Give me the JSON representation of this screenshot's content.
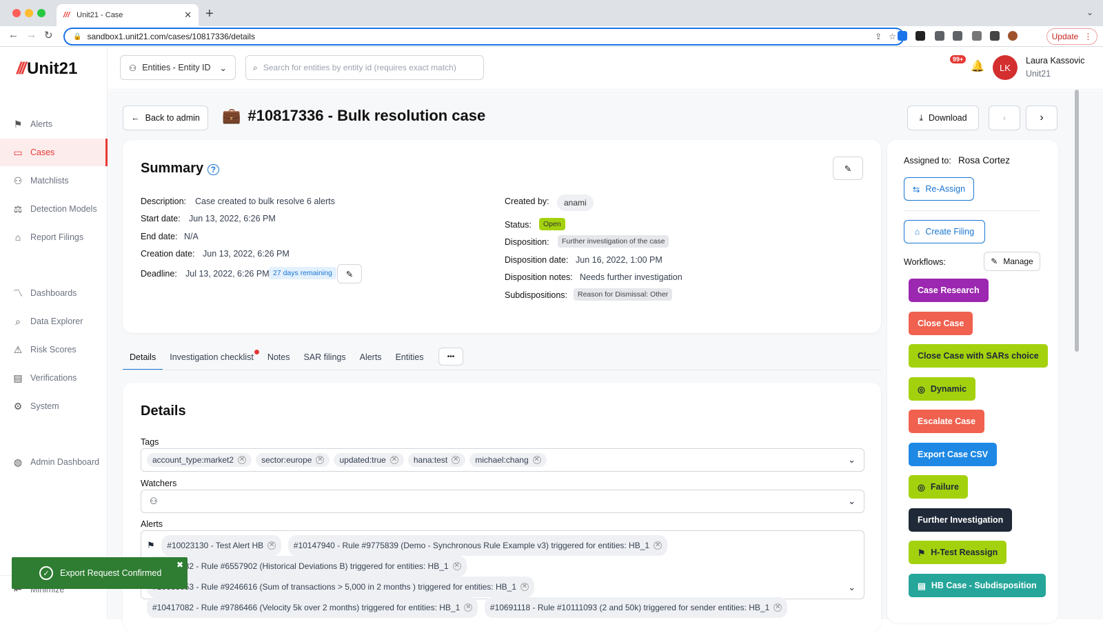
{
  "browser": {
    "tab_title": "Unit21 - Case",
    "url": "sandbox1.unit21.com/cases/10817336/details",
    "update_label": "Update"
  },
  "app": {
    "logo": "Unit21"
  },
  "sidebar": {
    "items": [
      {
        "label": "Alerts",
        "icon": "flag-icon"
      },
      {
        "label": "Cases",
        "icon": "briefcase-icon",
        "active": true
      },
      {
        "label": "Matchlists",
        "icon": "user-x-icon"
      },
      {
        "label": "Detection Models",
        "icon": "scale-icon"
      },
      {
        "label": "Report Filings",
        "icon": "bank-icon"
      },
      {
        "label": "Dashboards",
        "icon": "chart-line-icon"
      },
      {
        "label": "Data Explorer",
        "icon": "search-data-icon"
      },
      {
        "label": "Risk Scores",
        "icon": "warning-icon"
      },
      {
        "label": "Verifications",
        "icon": "id-card-icon"
      },
      {
        "label": "System",
        "icon": "gear-icon"
      },
      {
        "label": "Admin Dashboard",
        "icon": "globe-icon"
      }
    ],
    "minimize": "Minimize"
  },
  "topbar": {
    "entity_select": "Entities - Entity ID",
    "search_placeholder": "Search for entities by entity id (requires exact match)",
    "notif_count": "99+",
    "avatar_initials": "LK",
    "user_name": "Laura Kassovic",
    "user_org": "Unit21"
  },
  "header": {
    "back": "Back to admin",
    "title": "#10817336 - Bulk resolution case",
    "download": "Download"
  },
  "summary": {
    "title": "Summary",
    "description_label": "Description:",
    "description": "Case created to bulk resolve 6 alerts",
    "start_label": "Start date:",
    "start": "Jun 13, 2022, 6:26 PM",
    "end_label": "End date:",
    "end": "N/A",
    "creation_label": "Creation date:",
    "creation": "Jun 13, 2022, 6:26 PM",
    "deadline_label": "Deadline:",
    "deadline": "Jul 13, 2022, 6:26 PM",
    "deadline_badge": "27 days remaining",
    "created_by_label": "Created by:",
    "created_by": "anami",
    "status_label": "Status:",
    "status": "Open",
    "disposition_label": "Disposition:",
    "disposition": "Further investigation of the case",
    "disposition_date_label": "Disposition date:",
    "disposition_date": "Jun 16, 2022, 1:00 PM",
    "disposition_notes_label": "Disposition notes:",
    "disposition_notes": "Needs further investigation",
    "subdispositions_label": "Subdispositions:",
    "subdisposition": "Reason for Dismissal: Other"
  },
  "tabs": [
    "Details",
    "Investigation checklist",
    "Notes",
    "SAR filings",
    "Alerts",
    "Entities"
  ],
  "more": "•••",
  "details": {
    "title": "Details",
    "tags_label": "Tags",
    "tags": [
      "account_type:market2",
      "sector:europe",
      "updated:true",
      "hana:test",
      "michael:chang"
    ],
    "watchers_label": "Watchers",
    "alerts_label": "Alerts",
    "alerts": [
      "#10023130 - Test Alert HB",
      "#10147940 - Rule #9775839 (Demo - Synchronous Rule Example v3) triggered for entities: HB_1",
      "#10417082 - Rule #6557902 (Historical Deviations B) triggered for entities: HB_1",
      "#10688053 - Rule #9246616 (Sum of transactions > 5,000 in 2 months ) triggered for entities: HB_1",
      "#10417082 - Rule #9786466 (Velocity 5k over 2 months) triggered for entities: HB_1",
      "#10691118 - Rule #10111093 (2 and 50k) triggered for sender entities: HB_1"
    ]
  },
  "right": {
    "assigned_label": "Assigned to:",
    "assigned": "Rosa Cortez",
    "reassign": "Re-Assign",
    "create_filing": "Create Filing",
    "workflows_label": "Workflows:",
    "manage": "Manage",
    "workflows": [
      {
        "label": "Case Research",
        "color": "#9c27b0"
      },
      {
        "label": "Close Case",
        "color": "#f0614f"
      },
      {
        "label": "Close Case with SARs choice",
        "color": "#a4d10e"
      },
      {
        "label": "Dynamic",
        "color": "#a4d10e"
      },
      {
        "label": "Escalate Case",
        "color": "#f0614f"
      },
      {
        "label": "Export Case CSV",
        "color": "#1e88e5"
      },
      {
        "label": "Failure",
        "color": "#a4d10e"
      },
      {
        "label": "Further Investigation",
        "color": "#1f2937"
      },
      {
        "label": "H-Test Reassign",
        "color": "#a4d10e"
      },
      {
        "label": "HB Case - Subdisposition",
        "color": "#26a69a"
      }
    ]
  },
  "toast": {
    "message": "Export Request Confirmed"
  }
}
